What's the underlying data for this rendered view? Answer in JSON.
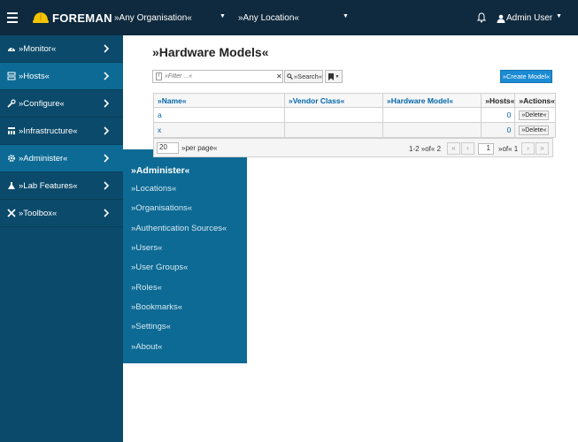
{
  "header": {
    "brand": "FOREMAN",
    "organisation": "»Any Organisation«",
    "location": "»Any Location«",
    "user": "Admin User"
  },
  "sidebar": {
    "items": [
      {
        "label": "»Monitor«",
        "icon": "dashboard-icon"
      },
      {
        "label": "»Hosts«",
        "icon": "server-icon"
      },
      {
        "label": "»Configure«",
        "icon": "wrench-icon"
      },
      {
        "label": "»Infrastructure«",
        "icon": "network-icon"
      },
      {
        "label": "»Administer«",
        "icon": "gear-icon"
      },
      {
        "label": "»Lab Features«",
        "icon": "flask-icon"
      },
      {
        "label": "»Toolbox«",
        "icon": "tools-icon"
      }
    ]
  },
  "flyout": {
    "title": "»Administer«",
    "items": [
      "»Locations«",
      "»Organisations«",
      "»Authentication Sources«",
      "»Users«",
      "»User Groups«",
      "»Roles«",
      "»Bookmarks«",
      "»Settings«",
      "»About«"
    ]
  },
  "page": {
    "title": "»Hardware Models«",
    "filter_placeholder": "»Filter ...«",
    "search_label": "»Search«",
    "create_label": "»Create Model«"
  },
  "table": {
    "columns": [
      "»Name«",
      "»Vendor Class«",
      "»Hardware Model«",
      "»Hosts«",
      "»Actions«"
    ],
    "rows": [
      {
        "name": "a",
        "vendor": "",
        "model": "",
        "hosts": "0",
        "action": "»Delete«"
      },
      {
        "name": "x",
        "vendor": "",
        "model": "",
        "hosts": "0",
        "action": "»Delete«"
      }
    ]
  },
  "pagination": {
    "per_page": "20",
    "per_page_label": "»per page«",
    "range": "1-2 »of« 2",
    "current_page": "1",
    "of_pages": "»of« 1"
  },
  "colors": {
    "topbar": "#0f2a3e",
    "sidebar": "#0b4a6a",
    "active": "#0c6a94",
    "primary_button": "#1b8bd4"
  }
}
